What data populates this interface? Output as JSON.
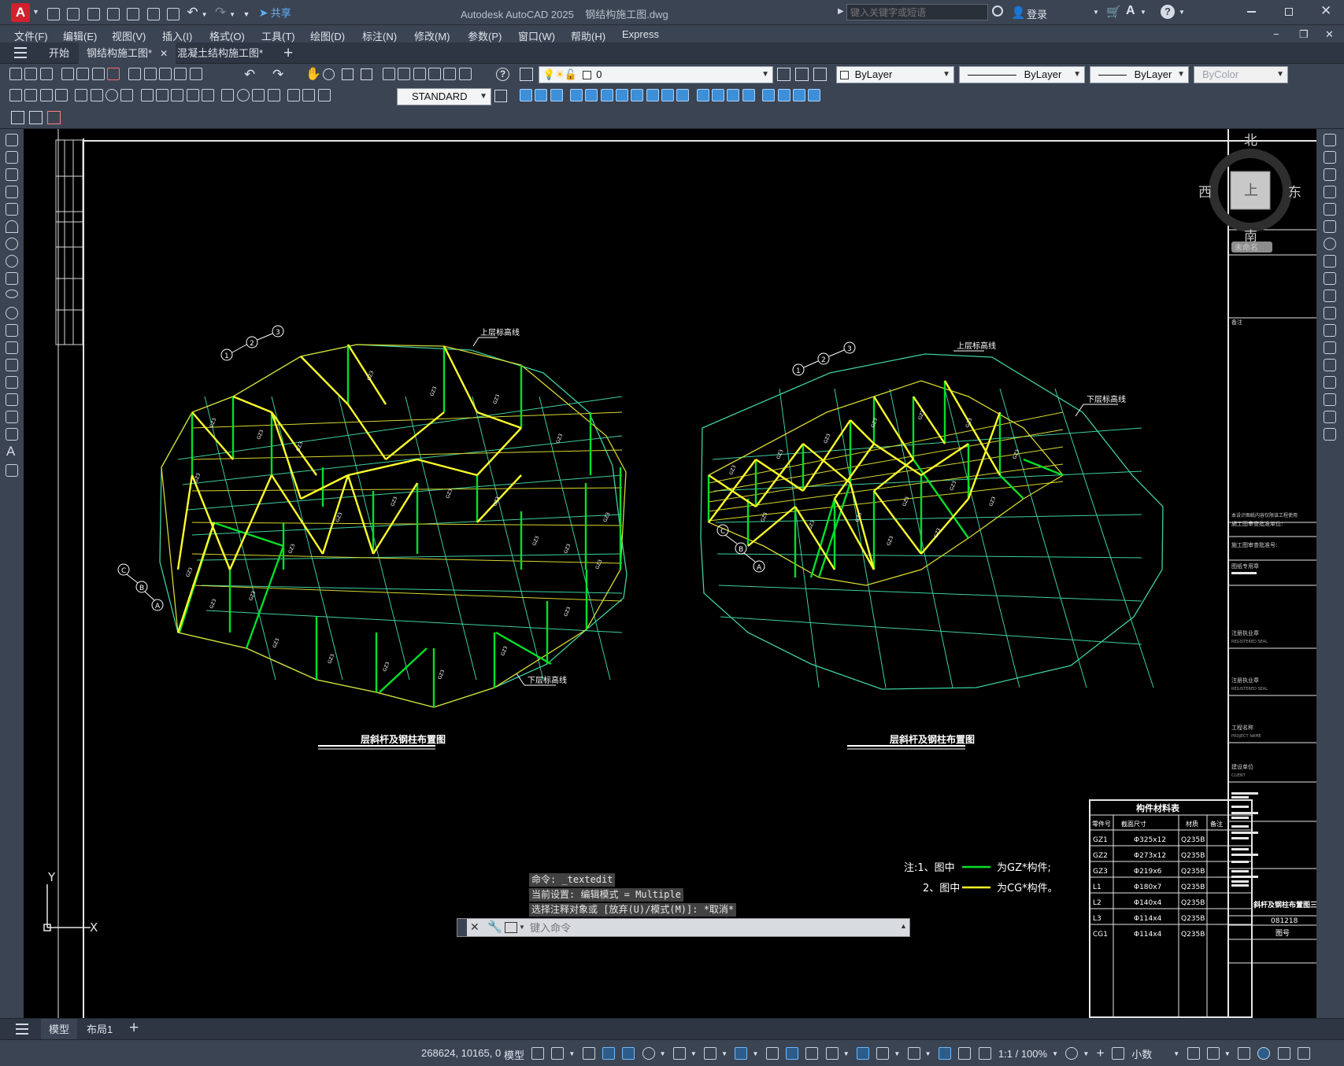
{
  "app": {
    "title": "Autodesk AutoCAD 2025",
    "filename": "钢结构施工图.dwg",
    "logo": "A",
    "share": "共享",
    "search_placeholder": "键入关键字或短语",
    "login": "登录"
  },
  "menu": [
    "文件(F)",
    "编辑(E)",
    "视图(V)",
    "插入(I)",
    "格式(O)",
    "工具(T)",
    "绘图(D)",
    "标注(N)",
    "修改(M)",
    "参数(P)",
    "窗口(W)",
    "帮助(H)",
    "Express"
  ],
  "tabs": [
    {
      "label": "开始",
      "active": false
    },
    {
      "label": "钢结构施工图*",
      "active": true
    },
    {
      "label": "混凝土结构施工图*",
      "active": false
    }
  ],
  "toolbar": {
    "layer_value": "0",
    "color_value": "ByLayer",
    "linetype_value": "ByLayer",
    "lineweight_value": "ByLayer",
    "plotstyle_value": "ByColor",
    "textstyle_value": "STANDARD"
  },
  "viewcube": {
    "north": "北",
    "south": "南",
    "east": "东",
    "west": "西",
    "top": "上",
    "wcs": "未命名"
  },
  "drawing": {
    "left_title": "层斜杆及钢柱布置图",
    "right_title": "层斜杆及钢柱布置图",
    "upper_chord_left": "上层标高线",
    "lower_chord_left": "下层标高线",
    "upper_chord_right": "上层标高线",
    "lower_chord_right": "下层标高线",
    "grid_labels": [
      "1",
      "2",
      "3",
      "A",
      "B",
      "C"
    ],
    "member_label": "GZ3",
    "note1_prefix": "注:1、图中",
    "note1_suffix": "为GZ*构件;",
    "note2_prefix": "2、图中",
    "note2_suffix": "为CG*构件。",
    "axis_y": "Y",
    "axis_x": "X"
  },
  "titleblock": {
    "remarks": "备注",
    "note_text": "本设计图纸内容仅限该工程使用",
    "contractor1": "施工图审查批准单位:",
    "contractor2": "施工图审查批准号:",
    "stamp": "图纸专用章",
    "reg1": "注册执业章",
    "reg1_sub": "REGISTERED SEAL",
    "reg2": "注册执业章",
    "reg2_sub": "REGISTERED SEAL",
    "project": "工程名称",
    "project_en": "PROJECT NAME",
    "client": "建设单位",
    "client_en": "CLIENT",
    "drawing_name": "斜杆及钢柱布置图三",
    "drawing_no": "081218",
    "sheet": "图号"
  },
  "material_table": {
    "title": "构件材料表",
    "headers": [
      "零件号",
      "截面尺寸",
      "材质",
      "备注"
    ],
    "rows": [
      [
        "GZ1",
        "Φ325x12",
        "Q235B",
        ""
      ],
      [
        "GZ2",
        "Φ273x12",
        "Q235B",
        ""
      ],
      [
        "GZ3",
        "Φ219x6",
        "Q235B",
        ""
      ],
      [
        "L1",
        "Φ180x7",
        "Q235B",
        ""
      ],
      [
        "L2",
        "Φ140x4",
        "Q235B",
        ""
      ],
      [
        "L3",
        "Φ114x4",
        "Q235B",
        ""
      ],
      [
        "CG1",
        "Φ114x4",
        "Q235B",
        ""
      ]
    ]
  },
  "command": {
    "history": [
      "命令: _textedit",
      "当前设置: 编辑模式 = Multiple",
      "选择注释对象或 [放弃(U)/模式(M)]: *取消*"
    ],
    "placeholder": "键入命令"
  },
  "layout_tabs": [
    {
      "label": "模型",
      "active": true
    },
    {
      "label": "布局1",
      "active": false
    }
  ],
  "status": {
    "coords": "268624, 10165, 0",
    "model": "模型",
    "scale": "1:1 / 100%",
    "units": "小数"
  },
  "colors": {
    "green_members": "#00e02a",
    "yellow_members": "#ffff2a",
    "lower_grid": "#3fd0a0",
    "upper_grid": "#d8d830"
  }
}
